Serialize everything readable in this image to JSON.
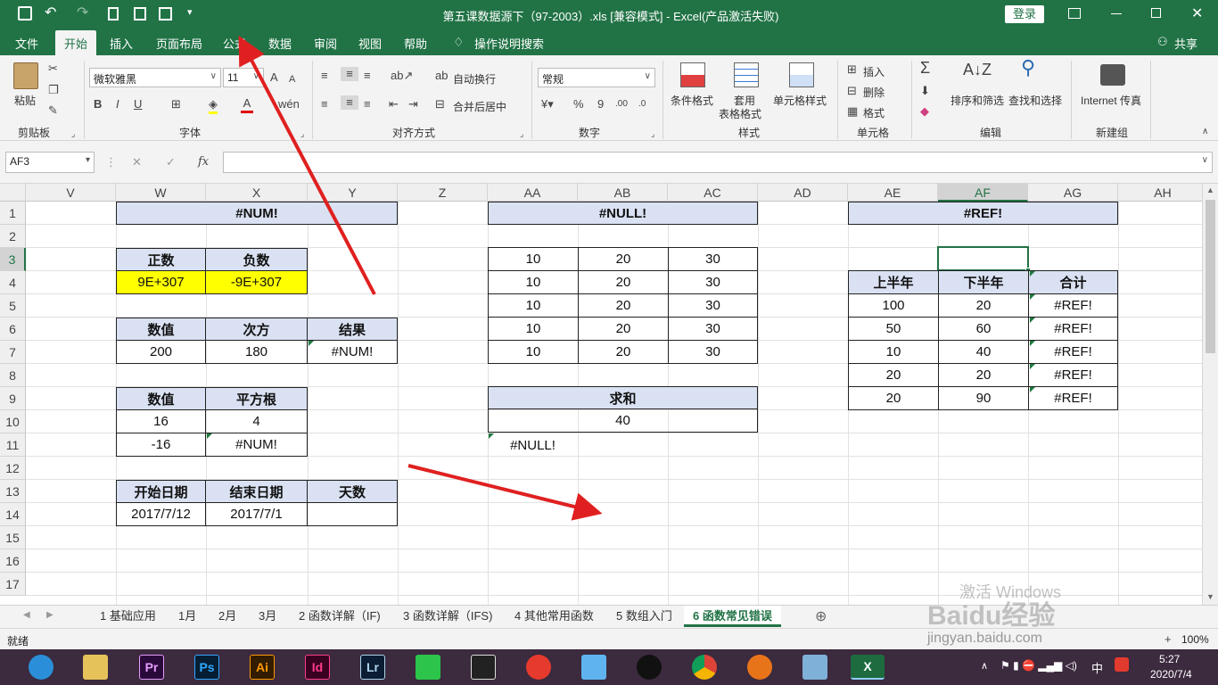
{
  "title": {
    "text": "第五课数据源下（97-2003）.xls  [兼容模式]  -  Excel(产品激活失败)",
    "login": "登录"
  },
  "tabs": [
    "文件",
    "开始",
    "插入",
    "页面布局",
    "公式",
    "数据",
    "审阅",
    "视图",
    "帮助"
  ],
  "tellme": "操作说明搜索",
  "share": "共享",
  "ribbon": {
    "clipboard": {
      "paste": "粘贴",
      "label": "剪贴板"
    },
    "font": {
      "name": "微软雅黑",
      "size": "11",
      "label": "字体",
      "bold": "B",
      "italic": "I",
      "underline": "U",
      "color_a": "A"
    },
    "alignment": {
      "wrap": "自动换行",
      "merge": "合并后居中",
      "label": "对齐方式"
    },
    "number": {
      "format": "常规",
      "label": "数字",
      "percent": "%",
      "comma": "9"
    },
    "styles": {
      "cond": "条件格式",
      "table": "套用",
      "table2": "表格格式",
      "cell": "单元格样式",
      "label": "样式"
    },
    "cells": {
      "insert": "插入",
      "delete": "删除",
      "format": "格式",
      "label": "单元格"
    },
    "editing": {
      "sort": "排序和筛选",
      "find": "查找和选择",
      "label": "编辑"
    },
    "newgroup": {
      "fax": "Internet 传真",
      "label": "新建组"
    }
  },
  "formula": {
    "namebox": "AF3",
    "fx": "fx",
    "value": ""
  },
  "columns": [
    "V",
    "W",
    "X",
    "Y",
    "Z",
    "AA",
    "AB",
    "AC",
    "AD",
    "AE",
    "AF",
    "AG",
    "AH"
  ],
  "rows": [
    "1",
    "2",
    "3",
    "4",
    "5",
    "6",
    "7",
    "8",
    "9",
    "10",
    "11",
    "12",
    "13",
    "14",
    "15",
    "16",
    "17"
  ],
  "cells": {
    "num_title": "#NUM!",
    "pos_h": "正数",
    "neg_h": "负数",
    "pos_v": "9E+307",
    "neg_v": "-9E+307",
    "val_h": "数值",
    "pow_h": "次方",
    "res_h": "结果",
    "val_v": "200",
    "pow_v": "180",
    "res_v": "#NUM!",
    "val2_h": "数值",
    "sqrt_h": "平方根",
    "v16": "16",
    "s4": "4",
    "vm16": "-16",
    "snum": "#NUM!",
    "start_h": "开始日期",
    "end_h": "结束日期",
    "days_h": "天数",
    "start_v": "2017/7/12",
    "end_v": "2017/7/1",
    "days_v": "",
    "null_title": "#NULL!",
    "null_rows": [
      [
        "10",
        "20",
        "30"
      ],
      [
        "10",
        "20",
        "30"
      ],
      [
        "10",
        "20",
        "30"
      ],
      [
        "10",
        "20",
        "30"
      ],
      [
        "10",
        "20",
        "30"
      ]
    ],
    "sum_h": "求和",
    "sum_v": "40",
    "null_err": "#NULL!",
    "ref_title": "#REF!",
    "h1_h": "上半年",
    "h2_h": "下半年",
    "tot_h": "合计",
    "ref_rows": [
      [
        "100",
        "20",
        "#REF!"
      ],
      [
        "50",
        "60",
        "#REF!"
      ],
      [
        "10",
        "40",
        "#REF!"
      ],
      [
        "20",
        "20",
        "#REF!"
      ],
      [
        "20",
        "90",
        "#REF!"
      ]
    ]
  },
  "sheets": [
    "1 基础应用",
    "1月",
    "2月",
    "3月",
    "2 函数详解（IF)",
    "3 函数详解（IFS)",
    "4 其他常用函数",
    "5 数组入门",
    "6 函数常见错误"
  ],
  "status": {
    "ready": "就绪",
    "zoom": "100%",
    "plus": "+"
  },
  "taskbar": {
    "apps": [
      "Pr",
      "Ps",
      "Ai",
      "Id",
      "Lr"
    ],
    "ime": "中",
    "time": "5:27",
    "date": "2020/7/4"
  },
  "watermark": {
    "activate": "激活 Windows",
    "site": "jingyan.baidu.com",
    "brand": "Baidu经验"
  },
  "colors": {
    "excel_green": "#217346",
    "header_fill": "#d9e1f2",
    "yellow": "#ffff00",
    "arrow": "#e02020"
  }
}
